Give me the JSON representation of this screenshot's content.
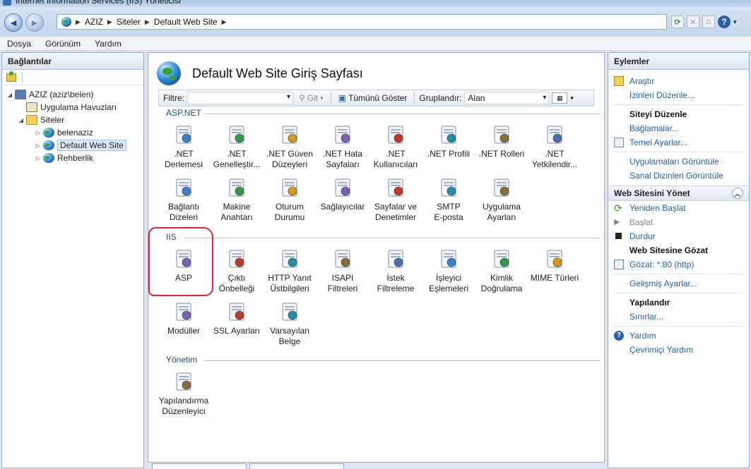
{
  "window": {
    "title": "Internet Information Services (IIS) Yöneticisi"
  },
  "address": {
    "crumbs": [
      "AZIZ",
      "Siteler",
      "Default Web Site"
    ]
  },
  "menu": {
    "items": [
      "Dosya",
      "Görünüm",
      "Yardım"
    ]
  },
  "connections": {
    "title": "Bağlantılar",
    "tree": [
      {
        "label": "AZIZ (aziz\\belen)",
        "level": 0,
        "icon": "server-icon"
      },
      {
        "label": "Uygulama Havuzları",
        "level": 1,
        "icon": "app-pool-icon"
      },
      {
        "label": "Siteler",
        "level": 1,
        "icon": "folder-icon"
      },
      {
        "label": "belenaziz",
        "level": 2,
        "icon": "globe-icon"
      },
      {
        "label": "Default Web Site",
        "level": 2,
        "icon": "globe-icon",
        "selected": true
      },
      {
        "label": "Rehberlik",
        "level": 2,
        "icon": "globe-icon"
      }
    ]
  },
  "center": {
    "title": "Default Web Site Giriş Sayfası",
    "filter": {
      "label": "Filtre:",
      "go": "Git",
      "show_all": "Tümünü Göster",
      "group_label": "Gruplandır:",
      "group_value": "Alan"
    },
    "sections": [
      {
        "title": "ASP.NET",
        "items": [
          {
            "label1": ".NET",
            "label2": "Derlemesi",
            "icon": "net-compilation-icon"
          },
          {
            "label1": ".NET",
            "label2": "Genelleştir...",
            "icon": "net-globalization-icon"
          },
          {
            "label1": ".NET Güven",
            "label2": "Düzeyleri",
            "icon": "net-trust-levels-icon"
          },
          {
            "label1": ".NET Hata",
            "label2": "Sayfaları",
            "icon": "net-error-pages-icon"
          },
          {
            "label1": ".NET",
            "label2": "Kullanıcıları",
            "icon": "net-users-icon"
          },
          {
            "label1": ".NET Profili",
            "label2": "",
            "icon": "net-profile-icon"
          },
          {
            "label1": ".NET Rolleri",
            "label2": "",
            "icon": "net-roles-icon"
          },
          {
            "label1": ".NET",
            "label2": "Yetkilendir...",
            "icon": "net-authorization-icon"
          },
          {
            "label1": "Bağlantı",
            "label2": "Dizeleri",
            "icon": "connection-strings-icon"
          },
          {
            "label1": "Makine",
            "label2": "Anahtarı",
            "icon": "machine-key-icon"
          },
          {
            "label1": "Oturum",
            "label2": "Durumu",
            "icon": "session-state-icon"
          },
          {
            "label1": "Sağlayıcılar",
            "label2": "",
            "icon": "providers-icon"
          },
          {
            "label1": "Sayfalar ve",
            "label2": "Denetimler",
            "icon": "pages-controls-icon"
          },
          {
            "label1": "SMTP",
            "label2": "E-posta",
            "icon": "smtp-email-icon"
          },
          {
            "label1": "Uygulama",
            "label2": "Ayarları",
            "icon": "app-settings-icon"
          }
        ]
      },
      {
        "title": "IIS",
        "items": [
          {
            "label1": "ASP",
            "label2": "",
            "icon": "asp-icon"
          },
          {
            "label1": "Çıktı",
            "label2": "Önbelleği",
            "icon": "output-cache-icon"
          },
          {
            "label1": "HTTP Yanıt",
            "label2": "Üstbilgileri",
            "icon": "http-headers-icon"
          },
          {
            "label1": "ISAPI",
            "label2": "Filtreleri",
            "icon": "isapi-filters-icon"
          },
          {
            "label1": "İstek",
            "label2": "Filtreleme",
            "icon": "request-filtering-icon"
          },
          {
            "label1": "İşleyici",
            "label2": "Eşlemeleri",
            "icon": "handler-mappings-icon"
          },
          {
            "label1": "Kimlik",
            "label2": "Doğrulama",
            "icon": "authentication-icon"
          },
          {
            "label1": "MIME Türleri",
            "label2": "",
            "icon": "mime-types-icon"
          },
          {
            "label1": "Modüller",
            "label2": "",
            "icon": "modules-icon"
          },
          {
            "label1": "SSL Ayarları",
            "label2": "",
            "icon": "ssl-settings-icon"
          },
          {
            "label1": "Varsayılan",
            "label2": "Belge",
            "icon": "default-document-icon"
          }
        ]
      },
      {
        "title": "Yönetim",
        "items": [
          {
            "label1": "Yapılandırma",
            "label2": "Düzenleyici",
            "icon": "config-editor-icon"
          }
        ]
      }
    ]
  },
  "actions": {
    "title": "Eylemler",
    "top": [
      {
        "label": "Araştır",
        "icon": "explore-icon"
      },
      {
        "label": "İzinleri Düzenle...",
        "icon": ""
      }
    ],
    "edit_site": {
      "title": "Siteyi Düzenle",
      "items": [
        {
          "label": "Bağlamalar...",
          "icon": ""
        },
        {
          "label": "Temel Ayarlar...",
          "icon": "basic-settings-icon"
        },
        {
          "label": "Uygulamaları Görüntüle",
          "icon": ""
        },
        {
          "label": "Sanal Dizinleri Görüntüle",
          "icon": ""
        }
      ]
    },
    "manage": {
      "title": "Web Sitesini Yönet",
      "restart": "Yeniden Başlat",
      "start": "Başlat",
      "stop": "Durdur",
      "browse_title": "Web Sitesine Gözat",
      "browse": "Gözat: *:80 (http)",
      "advanced": "Gelişmiş Ayarlar...",
      "configure_title": "Yapılandır",
      "limits": "Sınırlar...",
      "help": "Yardım",
      "online_help": "Çevrimiçi Yardım"
    }
  }
}
